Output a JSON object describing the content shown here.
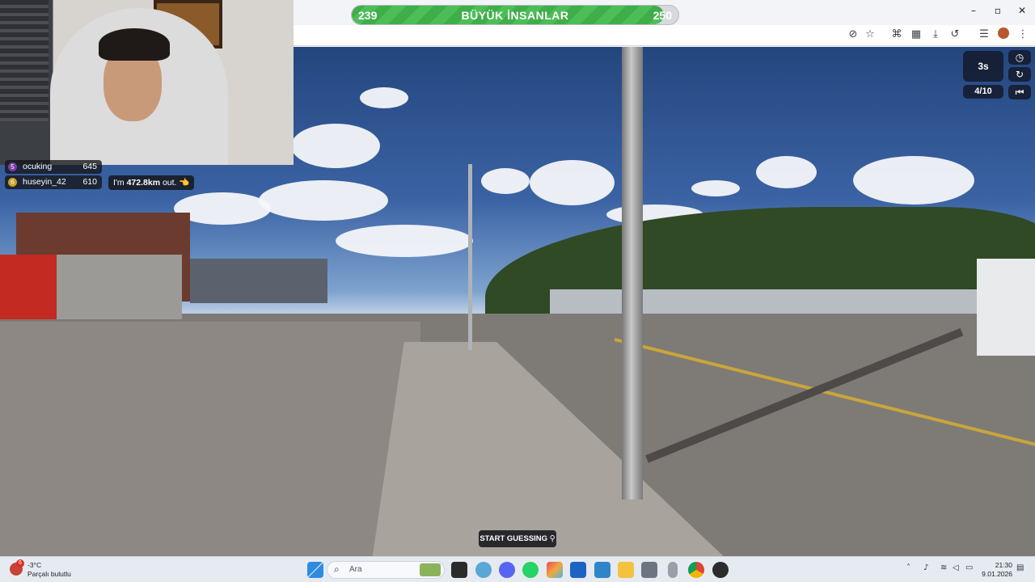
{
  "scoreboard": {
    "left_score": "239",
    "right_score": "250",
    "title": "BÜYÜK İNSANLAR",
    "progress_percent": 95.6
  },
  "leaderboard": [
    {
      "rank": "5",
      "name": "ocuking",
      "score": "645",
      "rank_color": "#7b3fa3"
    },
    {
      "rank": "6",
      "name": "huseyin_42",
      "score": "610",
      "rank_color": "#c9a227"
    }
  ],
  "guess_bubble": {
    "prefix": "I'm ",
    "distance": "472.8km",
    "suffix": " out.",
    "emoji": "👈"
  },
  "hud": {
    "timer": "3s",
    "round": "4/10",
    "clock_icon": "clock-icon",
    "refresh_icon": "refresh-icon",
    "rewind_icon": "rewind-icon"
  },
  "start_button": {
    "label": "START GUESSING",
    "icon": "map-pin-icon"
  },
  "browser": {
    "toolbar_icons": [
      "eye-off-icon",
      "star-icon",
      "translate-icon",
      "extensions-icon",
      "download-icon",
      "history-icon",
      "reading-list-icon",
      "profile-icon",
      "menu-icon"
    ],
    "window_controls": [
      "minimize-icon",
      "restore-icon",
      "close-icon"
    ]
  },
  "taskbar": {
    "weather_badge": "6",
    "weather_temp": "-3°C",
    "weather_desc": "Parçalı bulutlu",
    "search_placeholder": "Ara",
    "time": "21:30",
    "date": "9.01.2026"
  },
  "colors": {
    "score_green": "#3fae4a",
    "hud_bg": "#141a2c",
    "taskbar_bg": "#e6ebf2"
  }
}
